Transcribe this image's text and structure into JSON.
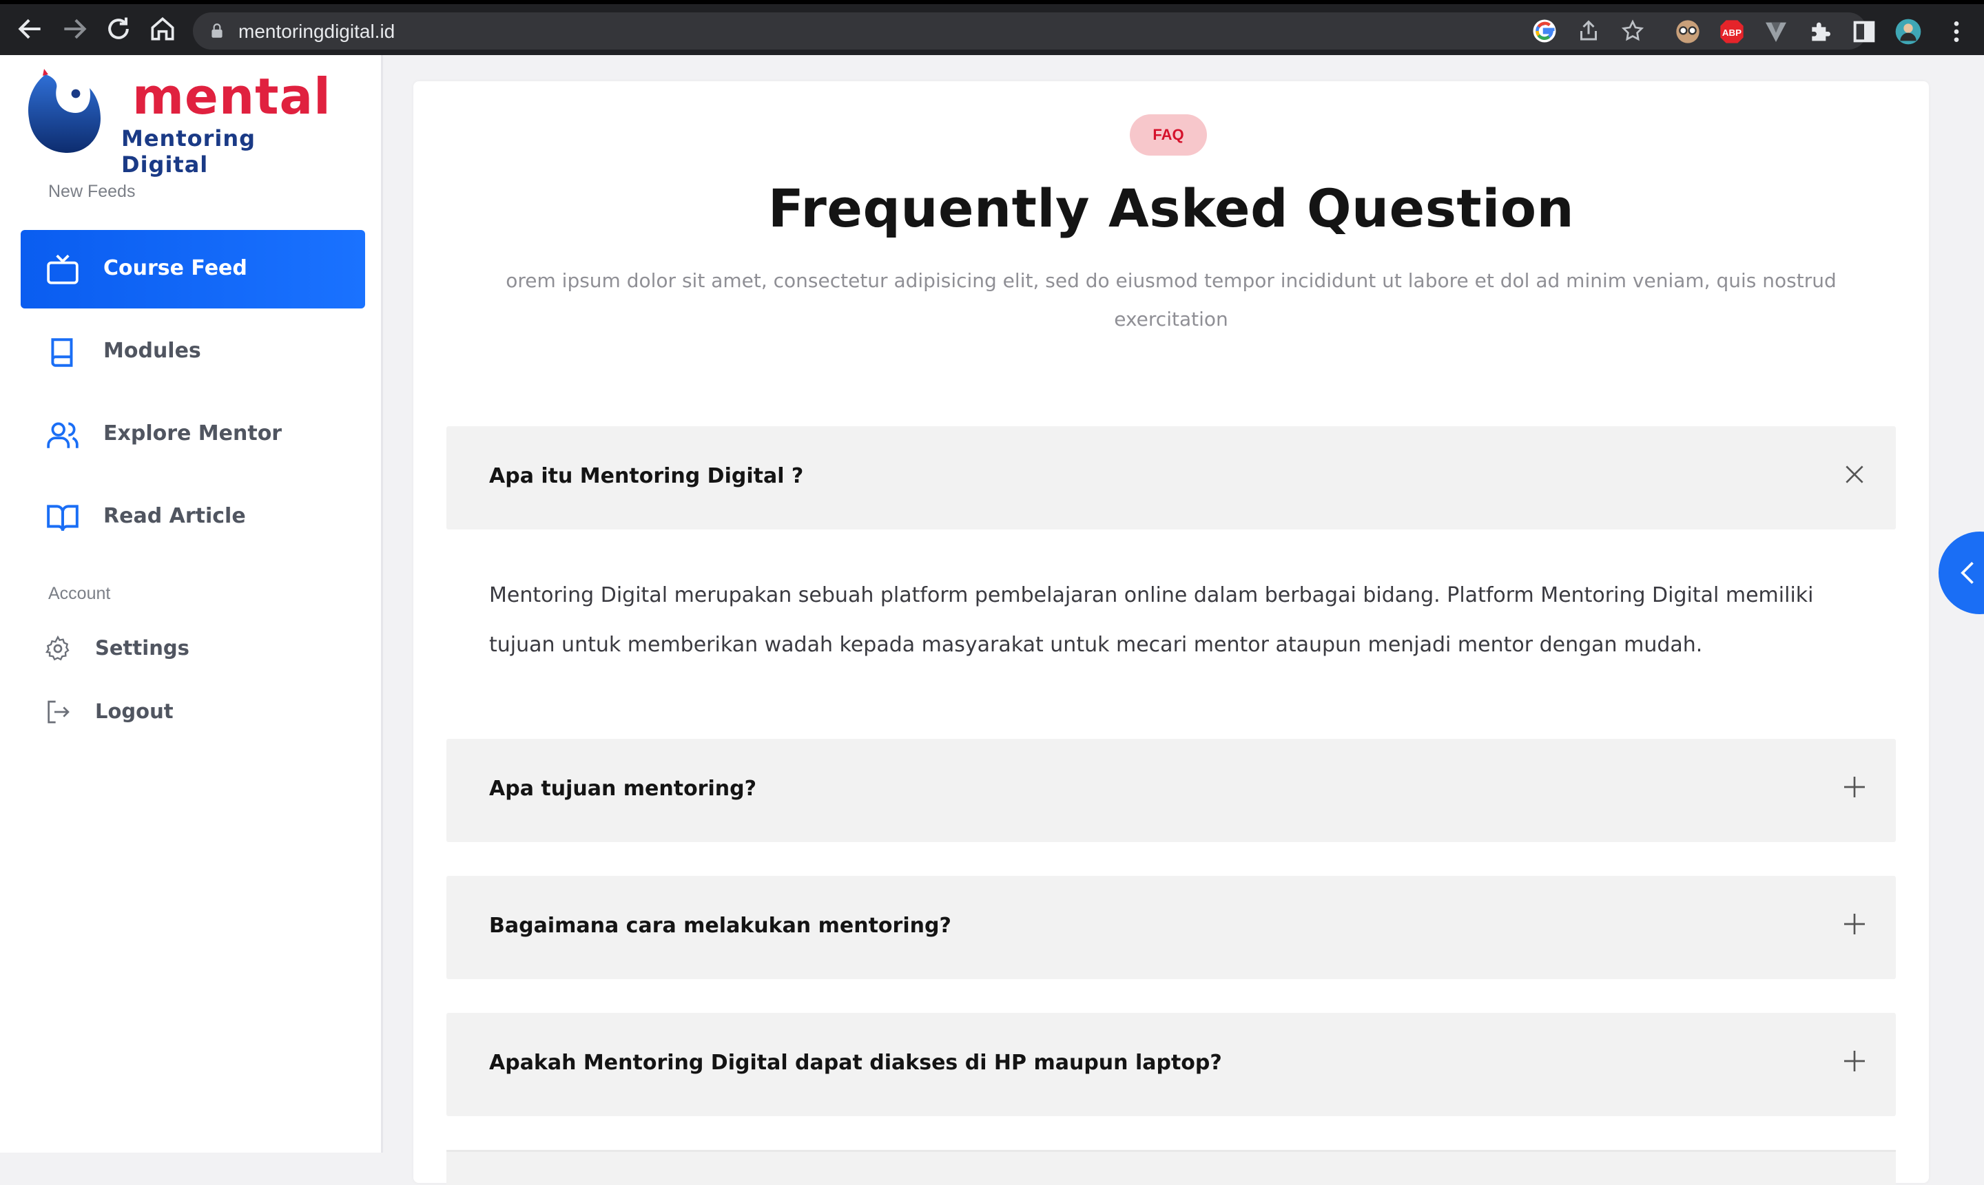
{
  "browser": {
    "url": "mentoringdigital.id",
    "extensions": [
      "glasses-extension",
      "adblock-plus",
      "vimium-extension",
      "puzzle-extensions",
      "sidebar-toggle",
      "profile-avatar"
    ],
    "adblock_label": "ABP"
  },
  "sidebar": {
    "logo": {
      "word_top": "mental",
      "word_bottom": "Mentoring Digital"
    },
    "section_feeds": "New Feeds",
    "items": [
      {
        "label": "Course Feed",
        "icon": "tv-icon",
        "active": true
      },
      {
        "label": "Modules",
        "icon": "book-icon",
        "active": false
      },
      {
        "label": "Explore Mentor",
        "icon": "users-icon",
        "active": false
      },
      {
        "label": "Read Article",
        "icon": "open-book-icon",
        "active": false
      }
    ],
    "section_account": "Account",
    "account_items": [
      {
        "label": "Settings",
        "icon": "gear-icon"
      },
      {
        "label": "Logout",
        "icon": "logout-icon"
      }
    ]
  },
  "main": {
    "badge": "FAQ",
    "title": "Frequently Asked Question",
    "subtitle": "orem ipsum dolor sit amet, consectetur adipisicing elit, sed do eiusmod tempor incididunt ut labore et dol ad minim veniam, quis nostrud exercitation",
    "faqs": [
      {
        "question": "Apa itu Mentoring Digital ?",
        "expanded": true,
        "answer": "Mentoring Digital merupakan sebuah platform pembelajaran online dalam berbagai bidang. Platform Mentoring Digital memiliki tujuan untuk memberikan wadah kepada masyarakat untuk mecari mentor ataupun menjadi mentor dengan mudah."
      },
      {
        "question": "Apa tujuan mentoring?",
        "expanded": false
      },
      {
        "question": "Bagaimana cara melakukan mentoring?",
        "expanded": false
      },
      {
        "question": "Apakah Mentoring Digital dapat diakses di HP maupun laptop?",
        "expanded": false
      }
    ]
  },
  "colors": {
    "accent": "#1a6ef5",
    "brand_red": "#e0213f",
    "brand_navy": "#1a3a86",
    "faq_badge_bg": "#f7c7cb"
  }
}
